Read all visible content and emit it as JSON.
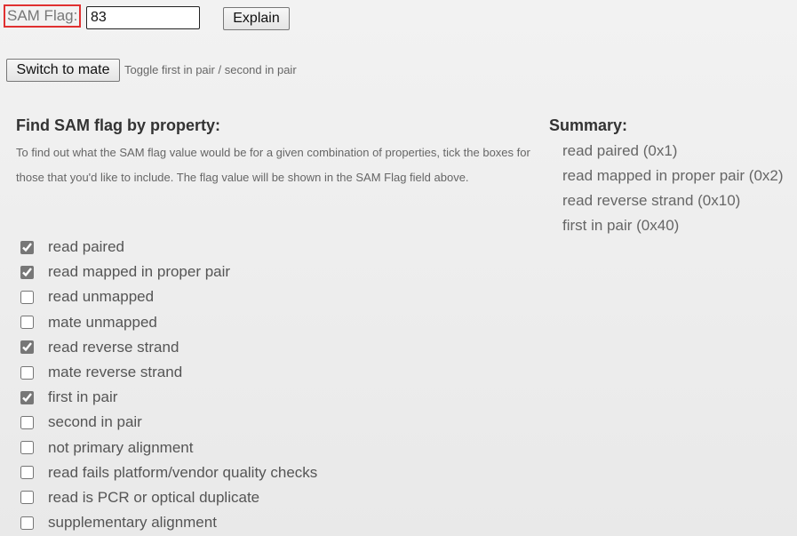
{
  "sam_flag": {
    "label": "SAM Flag:",
    "value": "83"
  },
  "buttons": {
    "explain": "Explain",
    "switch_to_mate": "Switch to mate"
  },
  "toggle_hint": "Toggle first in pair / second in pair",
  "find": {
    "title": "Find SAM flag by property:",
    "description": "To find out what the SAM flag value would be for a given combination of properties, tick the boxes for those that you'd like to include. The flag value will be shown in the SAM Flag field above."
  },
  "properties": [
    {
      "label": "read paired",
      "checked": true
    },
    {
      "label": "read mapped in proper pair",
      "checked": true
    },
    {
      "label": "read unmapped",
      "checked": false
    },
    {
      "label": "mate unmapped",
      "checked": false
    },
    {
      "label": "read reverse strand",
      "checked": true
    },
    {
      "label": "mate reverse strand",
      "checked": false
    },
    {
      "label": "first in pair",
      "checked": true
    },
    {
      "label": "second in pair",
      "checked": false
    },
    {
      "label": "not primary alignment",
      "checked": false
    },
    {
      "label": "read fails platform/vendor quality checks",
      "checked": false
    },
    {
      "label": "read is PCR or optical duplicate",
      "checked": false
    },
    {
      "label": "supplementary alignment",
      "checked": false
    }
  ],
  "summary": {
    "title": "Summary:",
    "items": [
      "read paired (0x1)",
      "read mapped in proper pair (0x2)",
      "read reverse strand (0x10)",
      "first in pair (0x40)"
    ]
  },
  "colors": {
    "highlight_border": "#e03131"
  }
}
